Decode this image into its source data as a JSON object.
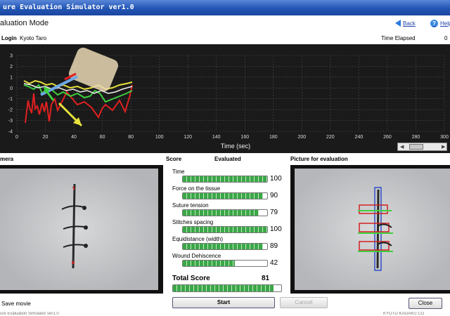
{
  "window": {
    "title": "ure Evaluation Simulator ver1.0"
  },
  "header": {
    "mode_title": "aluation Mode",
    "back_label": "Back",
    "help_label": "Help"
  },
  "login": {
    "label": "Login",
    "name": "Kyoto Taro",
    "elapsed_label": "Time Elapsed",
    "elapsed_value": "0"
  },
  "graph": {
    "xlabel": "Time (sec)",
    "xticks": [
      "0",
      "20",
      "40",
      "60",
      "80",
      "100",
      "120",
      "140",
      "160",
      "180",
      "200",
      "220",
      "240",
      "260",
      "280",
      "300"
    ],
    "yticks": [
      "3",
      "2",
      "1",
      "0",
      "-1",
      "-2",
      "-3",
      "-4"
    ],
    "xlim": [
      0,
      300
    ],
    "ylim": [
      -4,
      3
    ]
  },
  "sections": {
    "camera": "mera",
    "score": "Score",
    "evaluated": "Evaluated",
    "picture": "Picture for evaluation"
  },
  "metrics": [
    {
      "label": "Time",
      "value": 100,
      "fill": 1.0
    },
    {
      "label": "Force on the tissue",
      "value": 90,
      "fill": 0.95
    },
    {
      "label": "Suture tension",
      "value": 79,
      "fill": 0.9
    },
    {
      "label": "Stitches spacing",
      "value": 100,
      "fill": 1.0
    },
    {
      "label": "Equidistance (width)",
      "value": 89,
      "fill": 0.95
    },
    {
      "label": "Wound Dehiscence",
      "value": 42,
      "fill": 0.62
    }
  ],
  "total": {
    "label": "Total Score",
    "value": "81",
    "fill": 0.93
  },
  "buttons": {
    "start": "Start",
    "cancel": "Cancel",
    "close": "Close",
    "save_movie": "Save movie"
  },
  "footer": {
    "left": "ure Evaluation Simulator ver1.0",
    "right": "KYOTO KAGAKU CO"
  }
}
